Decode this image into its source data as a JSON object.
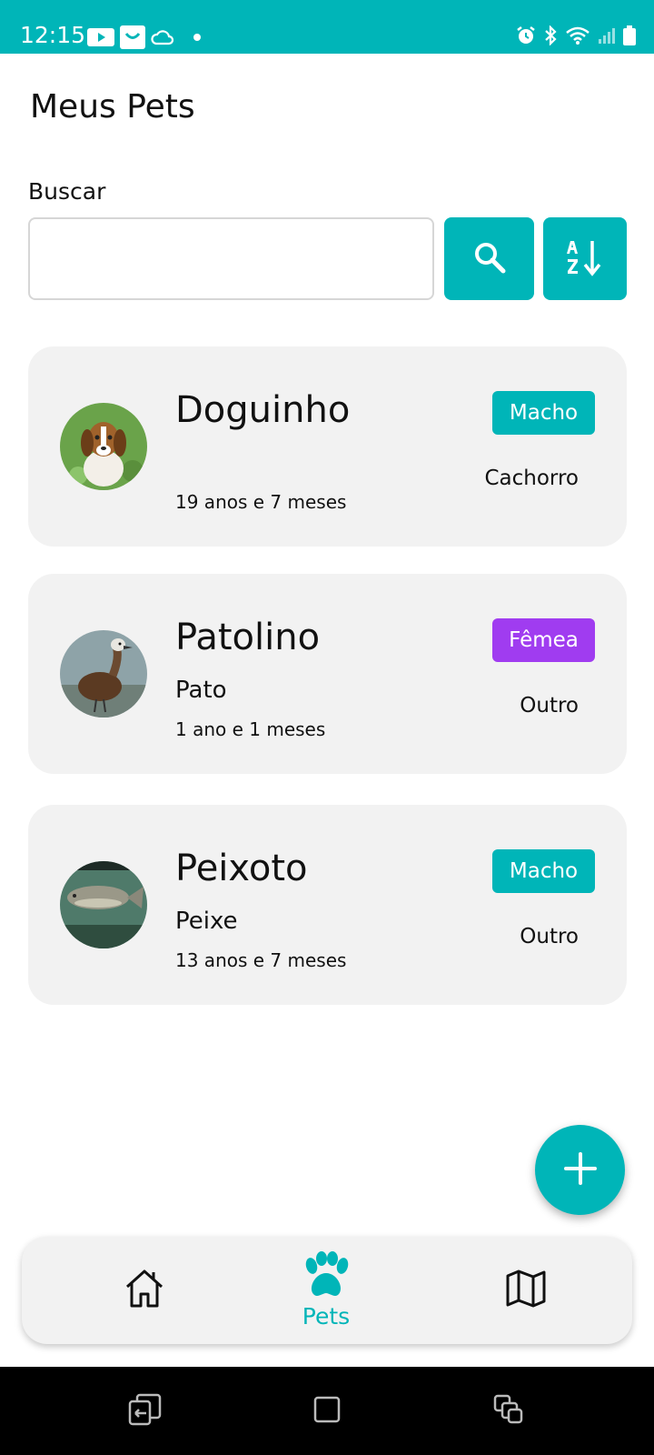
{
  "status_bar": {
    "time": "12:15",
    "left_icons": [
      "youtube-icon",
      "app-icon",
      "cloud-icon",
      "dot-icon"
    ],
    "right_icons": [
      "alarm-icon",
      "bluetooth-icon",
      "wifi-icon",
      "signal-icon",
      "battery-icon"
    ]
  },
  "page_title": "Meus Pets",
  "search": {
    "label": "Buscar",
    "value": "",
    "placeholder": "",
    "search_icon": "search-icon",
    "sort_icon": "sort-az-icon"
  },
  "pets": [
    {
      "name": "Doguinho",
      "breed": "",
      "age": "19 anos e 7 meses",
      "sex": "Macho",
      "species": "Cachorro"
    },
    {
      "name": "Patolino",
      "breed": "Pato",
      "age": "1 ano e 1 meses",
      "sex": "Fêmea",
      "species": "Outro"
    },
    {
      "name": "Peixoto",
      "breed": "Peixe",
      "age": "13 anos e 7 meses",
      "sex": "Macho",
      "species": "Outro"
    }
  ],
  "fab_icon": "plus-icon",
  "bottom_nav": {
    "items": [
      {
        "icon": "home-icon",
        "label": ""
      },
      {
        "icon": "paw-icon",
        "label": "Pets",
        "active": true
      },
      {
        "icon": "map-icon",
        "label": ""
      }
    ]
  },
  "colors": {
    "accent": "#00B5B8",
    "badge_male": "#00B5B8",
    "badge_female": "#A03CF0",
    "card_bg": "#F2F2F2"
  }
}
